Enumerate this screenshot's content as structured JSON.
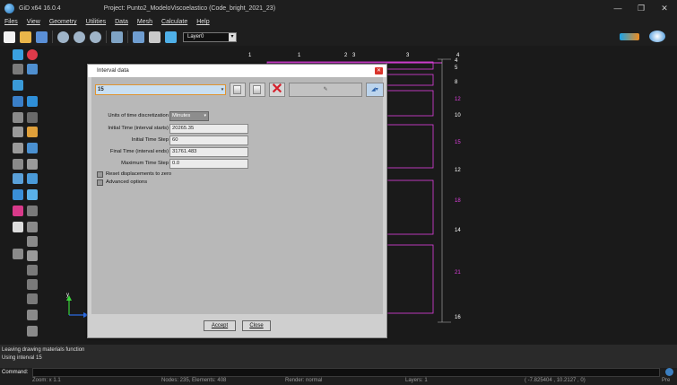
{
  "window": {
    "app_version": "GiD x64 16.0.4",
    "project_title": "Project: Punto2_ModeloViscoelastico (Code_bright_2021_23)",
    "controls": [
      "—",
      "❐",
      "✕"
    ]
  },
  "menu": [
    "Files",
    "View",
    "Geometry",
    "Utilities",
    "Data",
    "Mesh",
    "Calculate",
    "Help"
  ],
  "toolbar": {
    "layer_value": "Layer0"
  },
  "canvas": {
    "top_labels": [
      "1",
      "1",
      "2",
      "3",
      "3",
      "4"
    ],
    "right_labels": [
      "4",
      "5",
      "8",
      "12",
      "10",
      "15",
      "12",
      "18",
      "14",
      "21",
      "16"
    ],
    "axis_y": "y",
    "axis_x": "x"
  },
  "dialog": {
    "title": "Interval data",
    "interval_value": "15",
    "units_label": "Units of time discretization",
    "units_value": "Minutes",
    "initial_time_label": "Initial Time (interval starts)",
    "initial_time_value": "20265.35",
    "initial_step_label": "Initial Time Step",
    "initial_step_value": "60",
    "final_time_label": "Final Time (interval ends)",
    "final_time_value": "31761.483",
    "max_step_label": "Maximum Time Step",
    "max_step_value": "0.0",
    "reset_label": "Reset displacements to zero",
    "advanced_label": "Advanced options",
    "accept_label": "Accept",
    "close_label": "Close"
  },
  "messages": {
    "line1": "Leaving drawing materials function",
    "line2": "Using interval 15"
  },
  "command": {
    "label": "Command:"
  },
  "status": {
    "zoom": "Zoom: x 1.1",
    "nodes": "Nodes: 235, Elements: 408",
    "render": "Render: normal",
    "layers": "Layers: 1",
    "coords": "( -7.825404 , 10.2127 , 0)",
    "pre": "Pre"
  }
}
